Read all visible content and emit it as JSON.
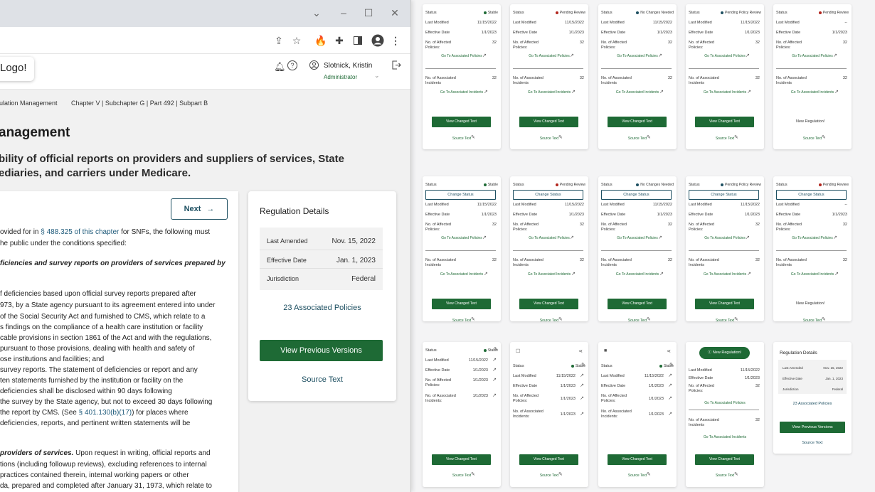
{
  "browser": {
    "window_controls": {
      "chevron": "chevron-down-icon",
      "minimize": "minimize-icon",
      "maximize": "maximize-icon",
      "close": "close-icon"
    },
    "toolbar_icons": [
      "share-icon",
      "star-icon",
      "fire-extension-icon",
      "puzzle-extension-icon",
      "sidepanel-icon",
      "profile-icon",
      "kebab-menu-icon"
    ]
  },
  "header": {
    "logo": "Logo!",
    "user_name": "Slotnick, Kristin",
    "user_role": "Administrator"
  },
  "breadcrumb": {
    "item1": "ulation Management",
    "item2": "Chapter V | Subchapter G | Part 492 | Subpart B"
  },
  "page": {
    "title": "anagement",
    "subtitle_line1": "bility of official reports on providers and suppliers of services, State",
    "subtitle_line2": "ediaries, and carriers under Medicare."
  },
  "text_panel": {
    "next_label": "Next",
    "l1a": "ovided for in ",
    "l1link": "§ 488.325 of this chapter",
    "l1b": " for SNFs, the following must",
    "l2": "he public under the conditions specified:",
    "l3": "ficiencies and survey reports on providers of services prepared by",
    "l5": "f deficiencies based upon official survey reports prepared after",
    "l6": "973, by a State agency pursuant to its agreement entered into under",
    "l7": "of the Social Security Act and furnished to CMS, which relate to a",
    "l8": "s findings on the compliance of a health care institution or facility",
    "l9": "cable provisions in section 1861 of the Act and with the regulations,",
    "l10": "pursuant to those provisions, dealing with health and safety of",
    "l11": "ose institutions and facilities; and",
    "l12": "survey reports. The statement of deficiencies or report and any",
    "l13": "ten statements furnished by the institution or facility on the",
    "l14": "deficiencies shall be disclosed within 90 days following",
    "l15": "the survey by the State agency, but not to exceed 30 days following",
    "l16a": "the report by CMS. (See ",
    "l16link": "§ 401.130(b)(17)",
    "l16b": ") for places where",
    "l17": "deficiencies, reports, and pertinent written statements will be",
    "l19a": "providers of services.",
    "l19b": " Upon request in writing, official reports and",
    "l20": "tions (including followup reviews), excluding references to internal",
    "l21": "practices contained therein, internal working papers or other",
    "l22": "da, prepared and completed after January 31, 1973, which relate to"
  },
  "regulation_details": {
    "title": "Regulation Details",
    "rows": [
      {
        "label": "Last Amended",
        "value": "Nov. 15, 2022"
      },
      {
        "label": "Effective Date",
        "value": "Jan. 1, 2023"
      },
      {
        "label": "Jurisdiction",
        "value": "Federal"
      }
    ],
    "policies_link": "23 Associated Policies",
    "previous_versions": "View Previous Versions",
    "source_text": "Source Text"
  },
  "cards": {
    "labels": {
      "status": "Status",
      "last_modified": "Last Modified",
      "effective_date": "Effective Date",
      "affected_l1": "No. of Affected",
      "affected_l2": "Policies:",
      "assoc_l1": "No. of Associated",
      "assoc_l2": "Incidents",
      "assoc_l2b": "Incidents:",
      "go_policies": "Go To Associated Policies",
      "go_incidents": "Go To Associated Incidents",
      "view_changed": "View Changed Text",
      "source_text": "Source Text",
      "change_status": "Change Status",
      "new_regulation": "New Regulation!"
    },
    "row1": [
      {
        "status": "Stable",
        "color": "#1e6a35",
        "last_modified": "11/15/2022",
        "effective": "1/1/2023",
        "affected": "32",
        "incidents": "32"
      },
      {
        "status": "Pending Review",
        "color": "#b3261e",
        "last_modified": "11/15/2022",
        "effective": "1/1/2023",
        "affected": "32",
        "incidents": "32"
      },
      {
        "status": "No Changes Needed",
        "color": "#1d4f61",
        "last_modified": "11/15/2022",
        "effective": "1/1/2023",
        "affected": "32",
        "incidents": "32"
      },
      {
        "status": "Pending Policy Review",
        "color": "#1d4f61",
        "last_modified": "11/15/2022",
        "effective": "1/1/2023",
        "affected": "32",
        "incidents": "32"
      },
      {
        "status": "Pending Review",
        "color": "#b3261e",
        "last_modified": "--",
        "effective": "1/1/2023",
        "affected": "32",
        "incidents": "32"
      }
    ],
    "row3": [
      {
        "status": "Stable",
        "last_modified": "11/15/2022",
        "effective": "1/1/2023",
        "affected": "1/1/2023",
        "incidents": "1/1/2023"
      },
      {
        "status": "Stable",
        "last_modified": "11/15/2022",
        "effective": "1/1/2023",
        "affected": "1/1/2023",
        "incidents": "1/1/2023"
      },
      {
        "status": "Stable",
        "last_modified": "11/15/2022",
        "effective": "1/1/2023",
        "affected": "1/1/2023",
        "incidents": "1/1/2023"
      },
      {
        "last_modified": "11/15/2022",
        "effective": "1/1/2023",
        "affected": "32",
        "incidents": "32"
      }
    ],
    "mini_details": {
      "title": "Regulation Details",
      "rows": [
        {
          "label": "Last Amended",
          "value": "Nov. 15, 2022"
        },
        {
          "label": "Effective Date",
          "value": "Jan. 1, 2023"
        },
        {
          "label": "Jurisdiction",
          "value": "Federal"
        }
      ],
      "policies_link": "23 Associated Policies",
      "previous_versions": "View Previous Versions",
      "source_text": "Source Text"
    }
  },
  "colors": {
    "primary_green": "#1e6a35",
    "navy": "#1d4f61",
    "danger": "#b3261e"
  }
}
